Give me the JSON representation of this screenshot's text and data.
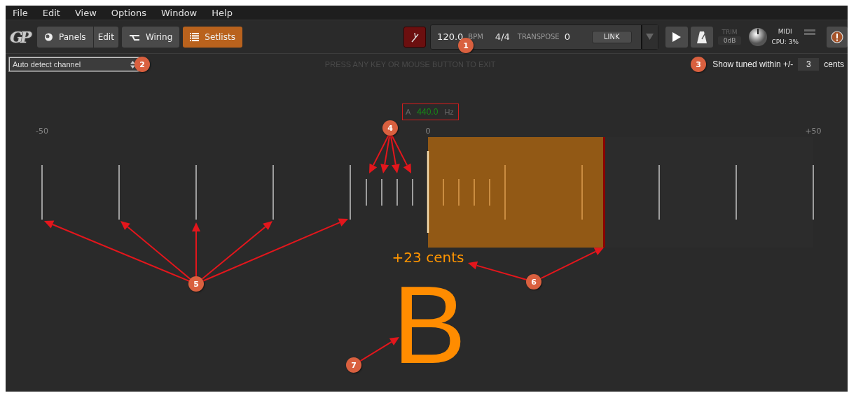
{
  "menu": [
    {
      "label": "File"
    },
    {
      "label": "Edit"
    },
    {
      "label": "View"
    },
    {
      "label": "Options"
    },
    {
      "label": "Window"
    },
    {
      "label": "Help"
    }
  ],
  "toolbar": {
    "logo": "GP",
    "views": [
      {
        "label": "Panels",
        "kind": "panels",
        "selected": false
      },
      {
        "label": "Edit",
        "kind": "text",
        "selected": false
      },
      {
        "label": "Wiring",
        "kind": "wiring",
        "selected": false
      },
      {
        "label": "Setlists",
        "kind": "setlists",
        "selected": true
      }
    ],
    "tuner_on": true,
    "transport": {
      "tempo": "120.0",
      "tempo_unit": "BPM",
      "time_signature": "4/4",
      "transpose_label": "TRANSPOSE",
      "transpose": "0",
      "link": "LINK"
    },
    "trim_label": "TRIM",
    "trim_value": "0dB",
    "midi_label": "MIDI",
    "cpu": "CPU: 3%"
  },
  "tuner_bar": {
    "channel_select": "Auto detect channel",
    "hint": "PRESS ANY KEY OR MOUSE BUTTON TO EXIT",
    "tolerance_label": "Show tuned within +/-",
    "tolerance": "3",
    "tolerance_unit": "cents"
  },
  "tuner": {
    "reference": {
      "note": "A",
      "frequency": "440.0",
      "unit": "Hz"
    },
    "scale": {
      "min_label": "-50",
      "center_label": "0",
      "max_label": "+50"
    },
    "deviation": {
      "level": 0.46,
      "reading": "+23 cents"
    },
    "note": "B"
  },
  "annotations": [
    {
      "label": "1"
    },
    {
      "label": "2"
    },
    {
      "label": "3"
    },
    {
      "label": "4"
    },
    {
      "label": "5"
    },
    {
      "label": "6"
    },
    {
      "label": "7"
    }
  ]
}
